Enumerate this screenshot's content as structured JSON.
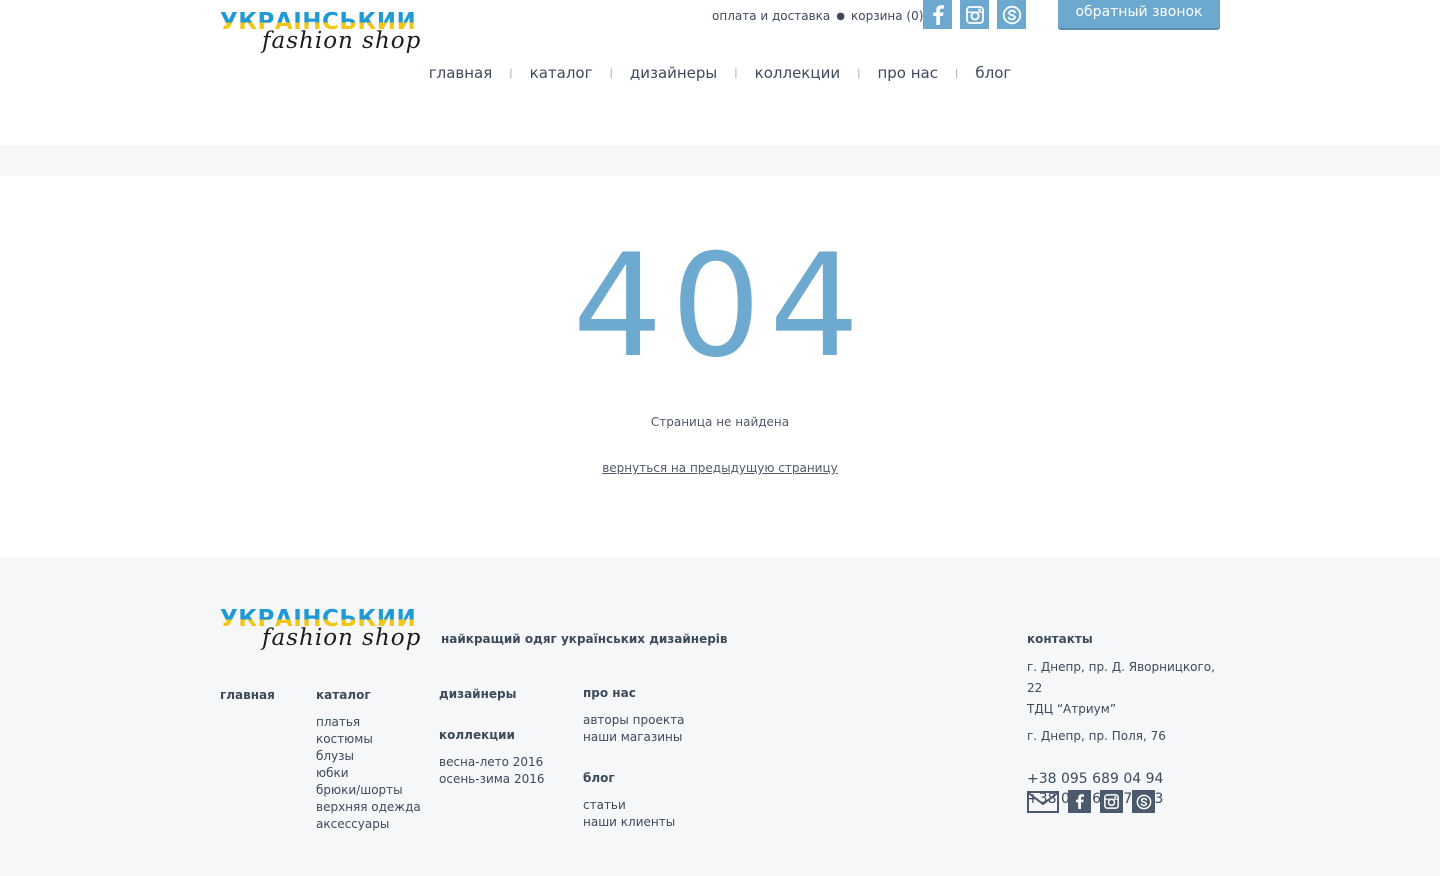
{
  "brand": {
    "logo_line1": "УКРАЇНСЬКИЙ",
    "logo_line2": "fashion shop"
  },
  "top_links": {
    "payment": "оплата и доставка",
    "cart": "корзина (0)"
  },
  "callback": "обратный звонок",
  "nav": [
    "главная",
    "каталог",
    "дизайнеры",
    "коллекции",
    "про нас",
    "блог"
  ],
  "error": {
    "code": "404",
    "message": "Страница не найдена",
    "back": "вернуться на предыдущую страницу"
  },
  "footer": {
    "tagline": "найкращий одяг українських дизайнерів",
    "col_main": "главная",
    "col_catalog": {
      "title": "каталог",
      "items": [
        "платья",
        "костюмы",
        "блузы",
        "юбки",
        "брюки/шорты",
        "верхняя одежда",
        "аксессуары"
      ]
    },
    "col_designers": "дизайнеры",
    "col_collections": {
      "title": "коллекции",
      "items": [
        "весна-лето 2016",
        "осень-зима 2016"
      ]
    },
    "col_about": {
      "title": "про нас",
      "items": [
        "авторы проекта",
        "наши магазины"
      ]
    },
    "col_blog": {
      "title": "блог",
      "items": [
        "статьи",
        "наши клиенты"
      ]
    },
    "contacts": {
      "title": "контакты",
      "addr1": "г. Днепр, пр. Д. Яворницкого, 22",
      "addr1b": "ТДЦ “Атриум”",
      "addr2": "г. Днепр, пр. Поля, 76",
      "phone1": "+38 095 689 04 94",
      "phone2": "+38 097 671 71 23"
    }
  },
  "icons": [
    "facebook-icon",
    "instagram-icon",
    "skype-icon",
    "mail-icon"
  ],
  "colors": {
    "accent": "#6da9cf",
    "text": "#3d4a5c",
    "footer_bg": "#f6f7f9"
  }
}
